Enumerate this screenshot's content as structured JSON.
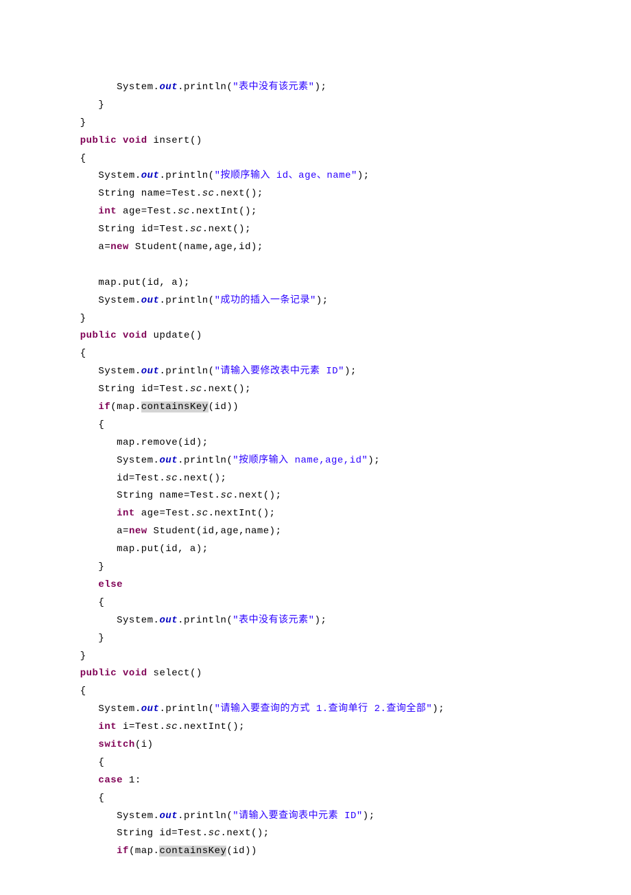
{
  "code": {
    "l1_indent": "         ",
    "l1a": "System.",
    "l1b": "out",
    "l1c": ".println(",
    "l1d": "\"表中没有该元素\"",
    "l1e": ");",
    "l2": "      }",
    "l3": "   }",
    "l4_indent": "   ",
    "l4a": "public void",
    "l4b": " insert()",
    "l5": "   {",
    "l6_indent": "      ",
    "l6a": "System.",
    "l6b": "out",
    "l6c": ".println(",
    "l6d": "\"按顺序输入 id、age、name\"",
    "l6e": ");",
    "l7_indent": "      ",
    "l7a": "String name=Test.",
    "l7b": "sc",
    "l7c": ".next();",
    "l8_indent": "      ",
    "l8a": "int",
    "l8b": " age=Test.",
    "l8c": "sc",
    "l8d": ".nextInt();",
    "l9_indent": "      ",
    "l9a": "String id=Test.",
    "l9b": "sc",
    "l9c": ".next();",
    "l10_indent": "      ",
    "l10a": "a=",
    "l10b": "new",
    "l10c": " Student(name,age,id);",
    "l11": "",
    "l12": "      map.put(id, a);",
    "l13_indent": "      ",
    "l13a": "System.",
    "l13b": "out",
    "l13c": ".println(",
    "l13d": "\"成功的插入一条记录\"",
    "l13e": ");",
    "l14": "   }",
    "l15_indent": "   ",
    "l15a": "public void",
    "l15b": " update()",
    "l16": "   {",
    "l17_indent": "      ",
    "l17a": "System.",
    "l17b": "out",
    "l17c": ".println(",
    "l17d": "\"请输入要修改表中元素 ID\"",
    "l17e": ");",
    "l18_indent": "      ",
    "l18a": "String id=Test.",
    "l18b": "sc",
    "l18c": ".next();",
    "l19_indent": "      ",
    "l19a": "if",
    "l19b": "(map.",
    "l19c": "containsKey",
    "l19d": "(id))",
    "l20": "      {",
    "l21": "         map.remove(id);",
    "l22_indent": "         ",
    "l22a": "System.",
    "l22b": "out",
    "l22c": ".println(",
    "l22d": "\"按顺序输入 name,age,id\"",
    "l22e": ");",
    "l23_indent": "         ",
    "l23a": "id=Test.",
    "l23b": "sc",
    "l23c": ".next();",
    "l24_indent": "         ",
    "l24a": "String name=Test.",
    "l24b": "sc",
    "l24c": ".next();",
    "l25_indent": "         ",
    "l25a": "int",
    "l25b": " age=Test.",
    "l25c": "sc",
    "l25d": ".nextInt();",
    "l26_indent": "         ",
    "l26a": "a=",
    "l26b": "new",
    "l26c": " Student(id,age,name);",
    "l27": "         map.put(id, a);",
    "l28": "      }",
    "l29_indent": "      ",
    "l29a": "else",
    "l30": "      {",
    "l31_indent": "         ",
    "l31a": "System.",
    "l31b": "out",
    "l31c": ".println(",
    "l31d": "\"表中没有该元素\"",
    "l31e": ");",
    "l32": "      }",
    "l33": "   }",
    "l34_indent": "   ",
    "l34a": "public void",
    "l34b": " select()",
    "l35": "   {",
    "l36_indent": "      ",
    "l36a": "System.",
    "l36b": "out",
    "l36c": ".println(",
    "l36d": "\"请输入要查询的方式 1.查询单行 2.查询全部\"",
    "l36e": ");",
    "l37_indent": "      ",
    "l37a": "int",
    "l37b": " i=Test.",
    "l37c": "sc",
    "l37d": ".nextInt();",
    "l38_indent": "      ",
    "l38a": "switch",
    "l38b": "(i)",
    "l39": "      {",
    "l40_indent": "      ",
    "l40a": "case",
    "l40b": " 1:",
    "l41": "      {",
    "l42_indent": "         ",
    "l42a": "System.",
    "l42b": "out",
    "l42c": ".println(",
    "l42d": "\"请输入要查询表中元素 ID\"",
    "l42e": ");",
    "l43_indent": "         ",
    "l43a": "String id=Test.",
    "l43b": "sc",
    "l43c": ".next();",
    "l44_indent": "         ",
    "l44a": "if",
    "l44b": "(map.",
    "l44c": "containsKey",
    "l44d": "(id))"
  }
}
